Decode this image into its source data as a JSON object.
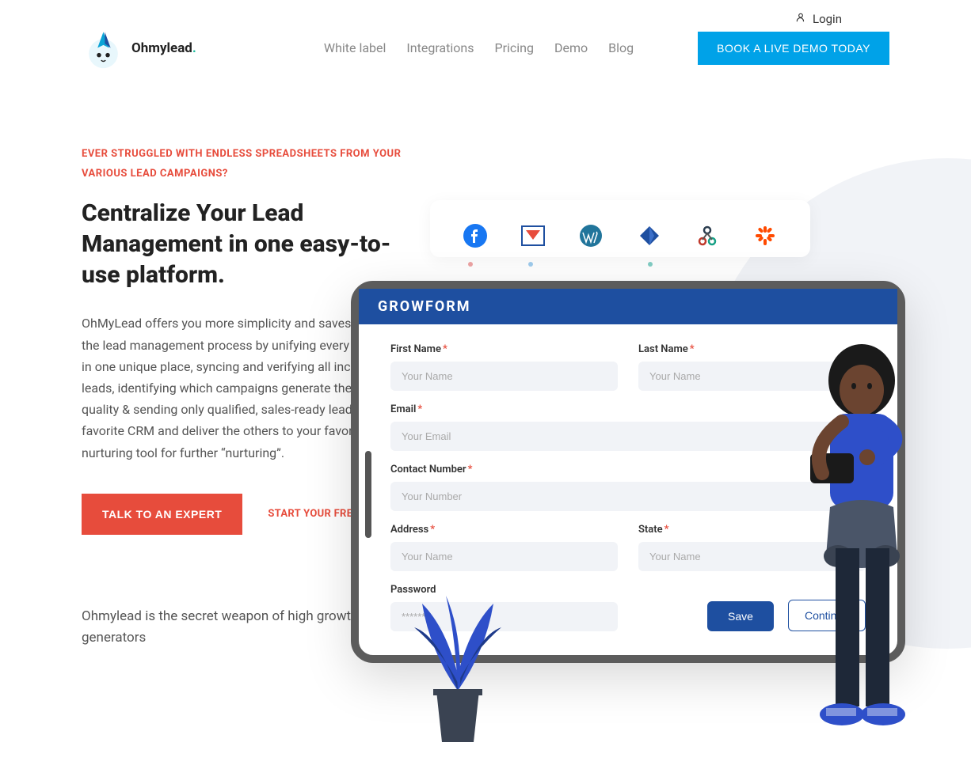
{
  "header": {
    "login": "Login",
    "logo_text": "Ohmylead",
    "nav": [
      {
        "label": "White label"
      },
      {
        "label": "Integrations"
      },
      {
        "label": "Pricing"
      },
      {
        "label": "Demo"
      },
      {
        "label": "Blog"
      }
    ],
    "demo_btn": "BOOK A LIVE DEMO TODAY"
  },
  "hero": {
    "eyebrow": "EVER STRUGGLED WITH ENDLESS SPREADSHEETS FROM YOUR VARIOUS LEAD CAMPAIGNS?",
    "title": "Centralize Your Lead Management in one easy-to-use platform.",
    "desc": "OhMyLead offers you more simplicity and saves you time in the lead management process by unifying every lead source in one unique place, syncing and verifying all incoming leads, identifying which campaigns generate the most quality & sending only qualified, sales-ready leads to your favorite CRM and deliver the others to your favorite lead nurturing tool for further “nurturing”.",
    "cta_primary": "TALK TO AN EXPERT",
    "cta_secondary": "START YOUR FREE TRIAL",
    "tagline": "Ohmylead is the secret weapon of high growth lead generators"
  },
  "form": {
    "header": "GROWFORM",
    "first_name": {
      "label": "First Name",
      "placeholder": "Your Name"
    },
    "last_name": {
      "label": "Last Name",
      "placeholder": "Your Name"
    },
    "email": {
      "label": "Email",
      "placeholder": "Your Email"
    },
    "contact": {
      "label": "Contact Number",
      "placeholder": "Your Number"
    },
    "address": {
      "label": "Address",
      "placeholder": "Your Name"
    },
    "state": {
      "label": "State",
      "placeholder": "Your Name"
    },
    "password": {
      "label": "Password",
      "placeholder": "*******"
    },
    "save": "Save",
    "continue": "Continue"
  },
  "colors": {
    "accent_blue": "#00a2e8",
    "accent_red": "#e74c3c",
    "form_blue": "#1e4fa0"
  }
}
